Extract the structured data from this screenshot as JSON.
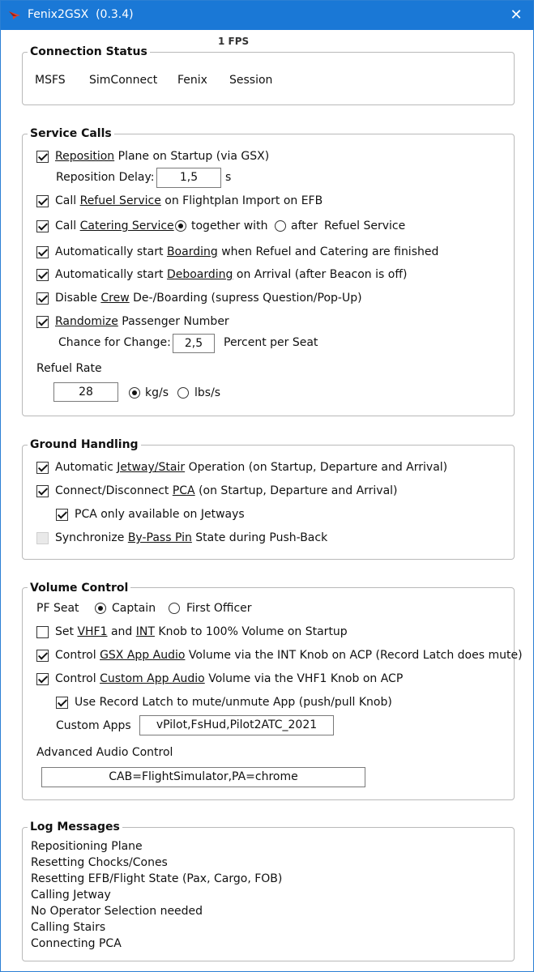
{
  "window": {
    "title": "Fenix2GSX  (0.3.4)",
    "close_glyph": "✕",
    "accent_color": "#1a78d6"
  },
  "fps": "1 FPS",
  "connection_status": {
    "legend": "Connection Status",
    "items": [
      "MSFS",
      "SimConnect",
      "Fenix",
      "Session"
    ],
    "status_color": "#1e6b1e"
  },
  "service_calls": {
    "legend": "Service Calls",
    "reposition": {
      "checked": true,
      "u": "Reposition",
      "rest": " Plane on Startup (via GSX)"
    },
    "reposition_delay": {
      "label": "Reposition Delay:",
      "value": "1,5",
      "unit": "s"
    },
    "refuel": {
      "checked": true,
      "pre": "Call ",
      "u": "Refuel Service",
      "rest": " on Flightplan Import on EFB"
    },
    "catering": {
      "checked": true,
      "pre": "Call ",
      "u": "Catering Service",
      "opt_together": "together with",
      "opt_after": "after",
      "suffix": "Refuel Service",
      "selected": "together with"
    },
    "boarding": {
      "checked": true,
      "pre": "Automatically start ",
      "u": "Boarding",
      "rest": " when Refuel and Catering are finished"
    },
    "deboarding": {
      "checked": true,
      "pre": "Automatically start ",
      "u": "Deboarding",
      "rest": " on Arrival (after Beacon is off)"
    },
    "crew": {
      "checked": true,
      "pre": "Disable ",
      "u": "Crew",
      "rest": " De-/Boarding (supress Question/Pop-Up)"
    },
    "randomize": {
      "checked": true,
      "u": "Randomize",
      "rest": " Passenger Number"
    },
    "chance": {
      "label": "Chance for Change:",
      "value": "2,5",
      "unit": "Percent per Seat"
    },
    "refuel_rate": {
      "label": "Refuel Rate",
      "value": "28",
      "opt_kgs": "kg/s",
      "opt_lbs": "lbs/s",
      "selected": "kg/s"
    }
  },
  "ground_handling": {
    "legend": "Ground Handling",
    "jetway": {
      "checked": true,
      "pre": "Automatic ",
      "u": "Jetway/Stair",
      "rest": " Operation (on Startup, Departure and Arrival)"
    },
    "pca": {
      "checked": true,
      "pre": "Connect/Disconnect ",
      "u": "PCA",
      "rest": " (on Startup, Departure and Arrival)"
    },
    "pca_jetways": {
      "checked": true,
      "label": "PCA only available on Jetways"
    },
    "bypass": {
      "checked": false,
      "disabled": true,
      "pre": "Synchronize ",
      "u": "By-Pass Pin",
      "rest": " State during Push-Back"
    }
  },
  "volume_control": {
    "legend": "Volume Control",
    "pf_seat": {
      "label": "PF Seat",
      "opt_captain": "Captain",
      "opt_fo": "First Officer",
      "selected": "Captain"
    },
    "vhf1_int": {
      "checked": false,
      "pre": "Set ",
      "u1": "VHF1",
      "mid": " and ",
      "u2": "INT",
      "rest": " Knob to 100% Volume on Startup"
    },
    "gsx_audio": {
      "checked": true,
      "pre": "Control ",
      "u": "GSX App Audio",
      "rest": " Volume via the INT Knob on ACP (Record Latch does mute)"
    },
    "custom_audio": {
      "checked": true,
      "pre": "Control ",
      "u": "Custom App Audio",
      "rest": " Volume via the VHF1 Knob on ACP"
    },
    "record_latch": {
      "checked": true,
      "label": "Use Record Latch to mute/unmute App (push/pull Knob)"
    },
    "custom_apps": {
      "label": "Custom Apps",
      "value": "vPilot,FsHud,Pilot2ATC_2021"
    },
    "advanced": {
      "label": "Advanced Audio Control",
      "value": "CAB=FlightSimulator,PA=chrome"
    }
  },
  "log_messages": {
    "legend": "Log Messages",
    "lines": [
      "Repositioning Plane",
      "Resetting Chocks/Cones",
      "Resetting EFB/Flight State (Pax, Cargo, FOB)",
      "Calling Jetway",
      "No Operator Selection needed",
      "Calling Stairs",
      "Connecting PCA"
    ]
  }
}
